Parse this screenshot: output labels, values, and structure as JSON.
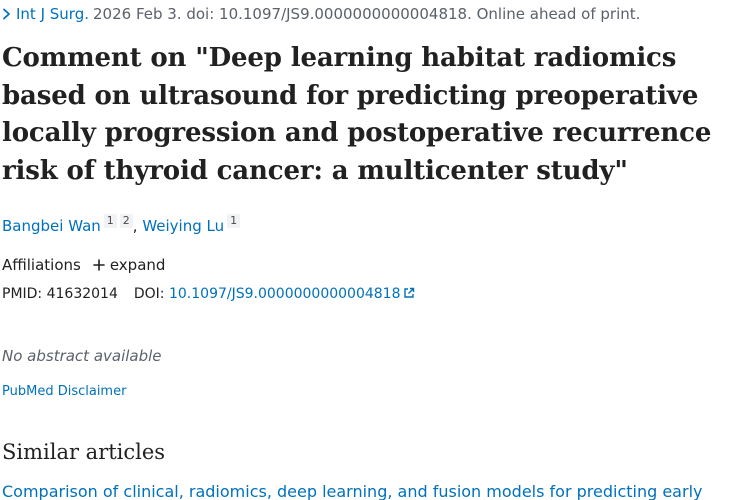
{
  "citation": {
    "journal": "Int J Surg.",
    "details": "2026 Feb 3. doi: 10.1097/JS9.0000000000004818. Online ahead of print."
  },
  "article": {
    "title": "Comment on \"Deep learning habitat radiomics based on ultrasound for predicting preoperative locally progression and postoperative recurrence risk of thyroid cancer: a multicenter study\""
  },
  "authors": [
    {
      "name": "Bangbei Wan",
      "affil_refs": [
        "1",
        "2"
      ]
    },
    {
      "name": "Weiying Lu",
      "affil_refs": [
        "1"
      ]
    }
  ],
  "affiliations": {
    "label": "Affiliations",
    "expand_label": "expand"
  },
  "identifiers": {
    "pmid_label": "PMID:",
    "pmid": "41632014",
    "doi_label": "DOI:",
    "doi": "10.1097/JS9.0000000000004818"
  },
  "abstract": {
    "text": "No abstract available"
  },
  "disclaimer": {
    "label": "PubMed Disclaimer"
  },
  "similar": {
    "heading": "Similar articles",
    "first_article": "Comparison of clinical, radiomics, deep learning, and fusion models for predicting early"
  },
  "colors": {
    "link": "#0071bc",
    "text": "#212121",
    "muted": "#5b616b"
  },
  "icons": {
    "citation_toggle": "chevron-right-icon",
    "expand": "plus-icon",
    "doi_external": "external-link-icon"
  }
}
